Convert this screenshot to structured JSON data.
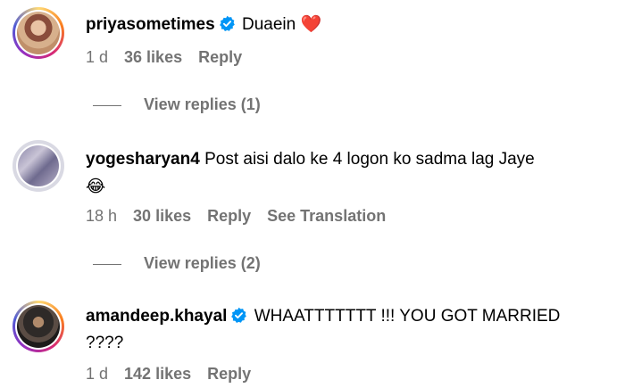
{
  "comments": [
    {
      "username": "priyasometimes",
      "verified": true,
      "text": "Duaein",
      "emoji": "❤️",
      "time": "1 d",
      "likes": "36 likes",
      "reply": "Reply",
      "view_replies": "View replies (1)"
    },
    {
      "username": "yogesharyan4",
      "verified": false,
      "text": "Post aisi dalo ke 4 logon ko sadma lag Jaye",
      "emoji": "😂",
      "time": "18 h",
      "likes": "30 likes",
      "reply": "Reply",
      "translation": "See Translation",
      "view_replies": "View replies (2)"
    },
    {
      "username": "amandeep.khayal",
      "verified": true,
      "text_line1": "WHAATTTTTTT !!! YOU GOT MARRIED",
      "text_line2": "????",
      "time": "1 d",
      "likes": "142 likes",
      "reply": "Reply"
    }
  ],
  "colors": {
    "secondary_text": "#737373",
    "verified_badge": "#0095f6",
    "heart": "#ed2a3c"
  }
}
